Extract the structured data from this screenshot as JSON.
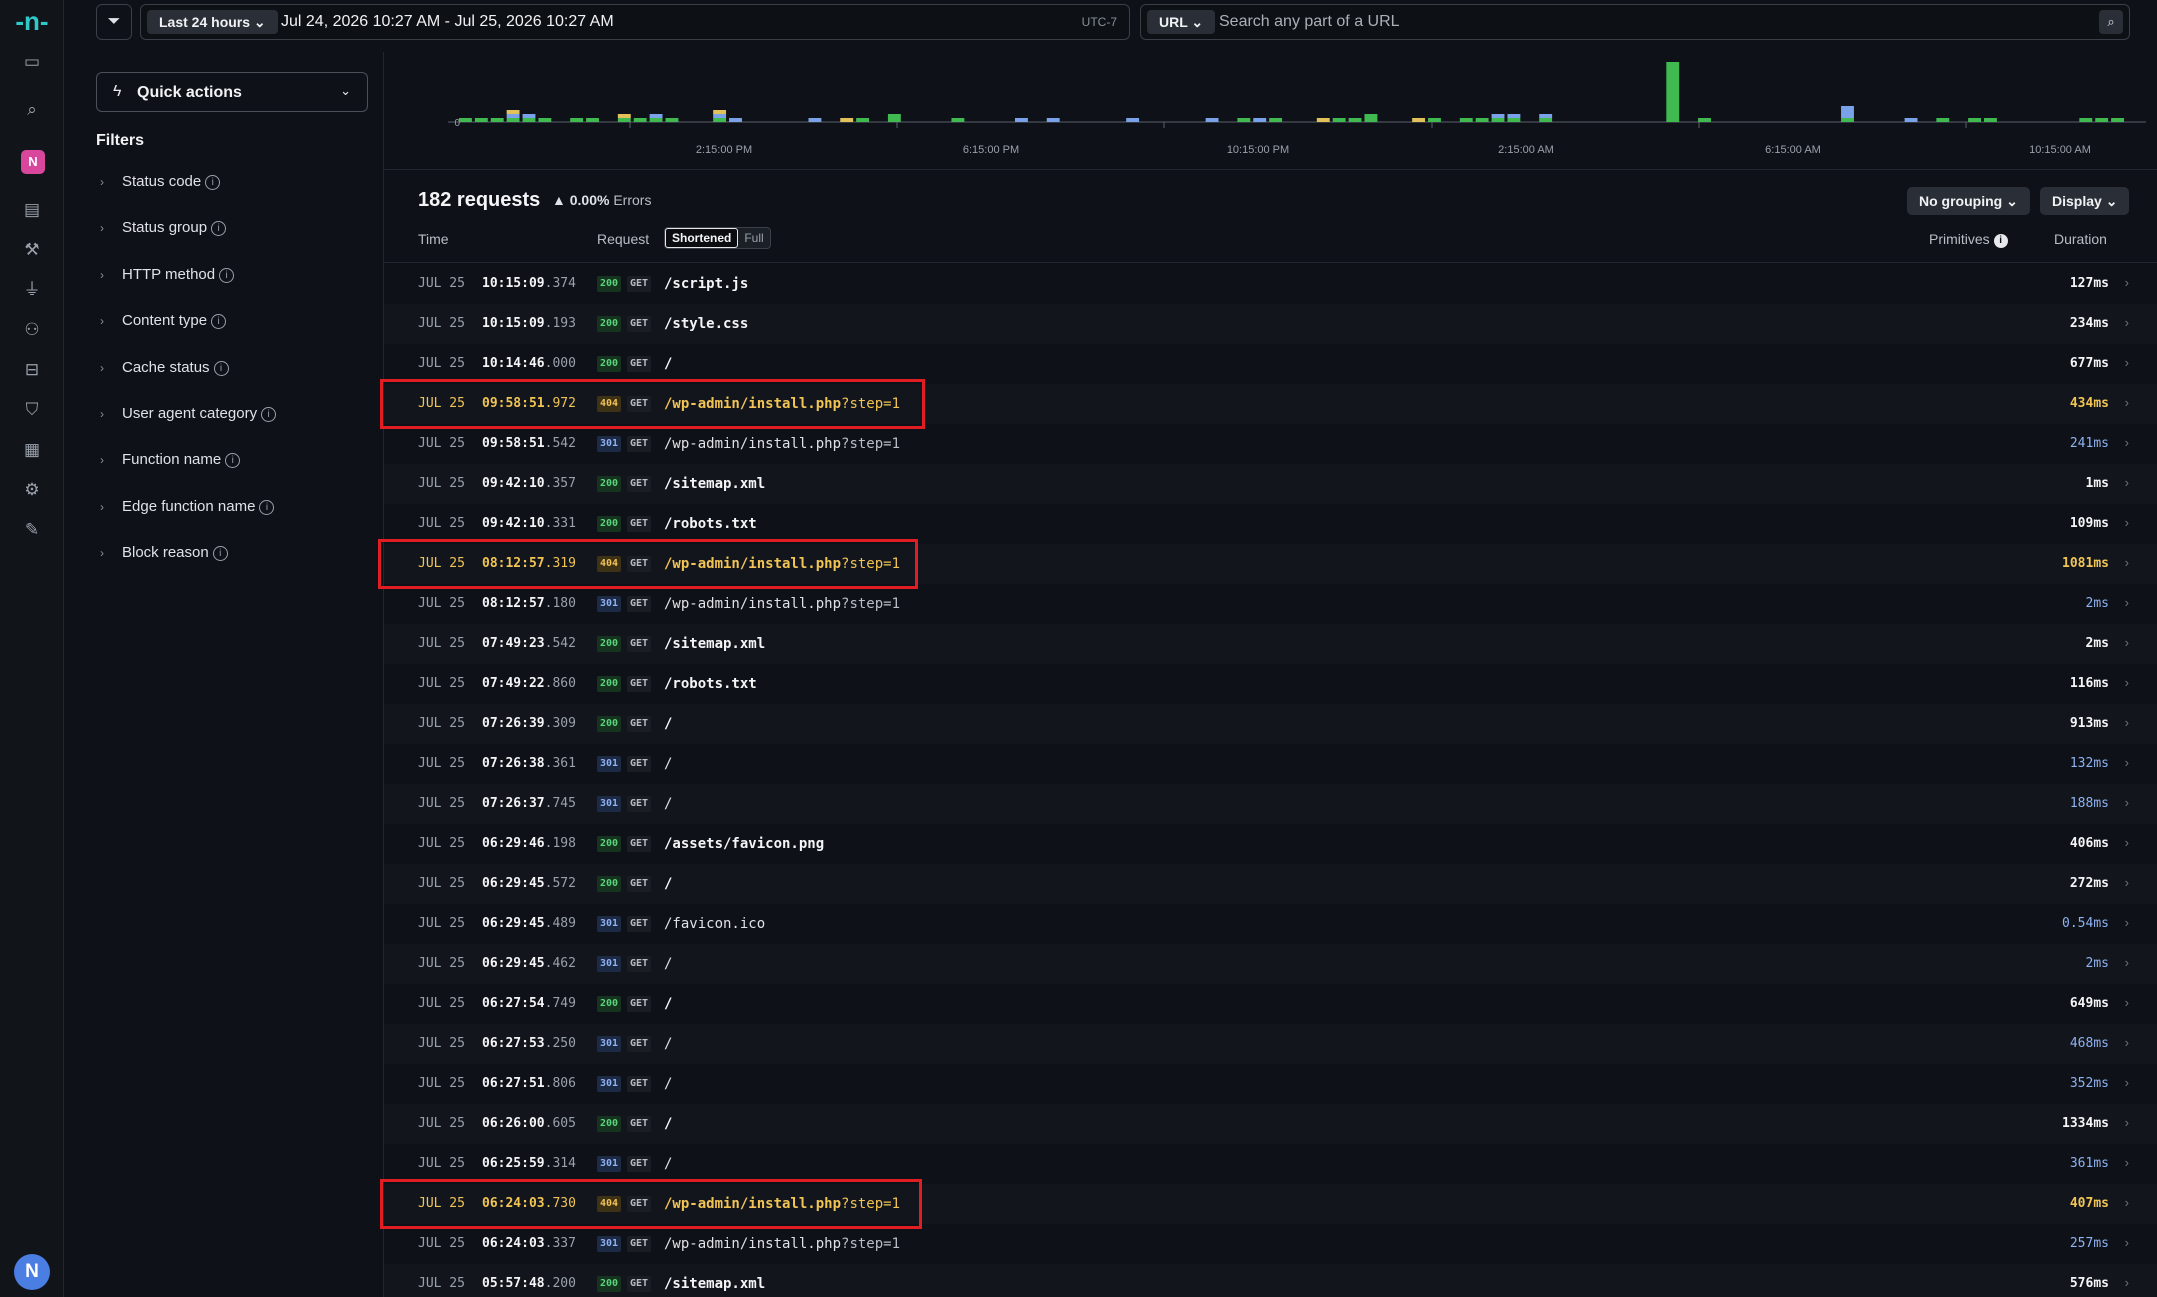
{
  "app": {
    "logo_glyph": "-n-",
    "team_initial": "N",
    "user_initial": "N"
  },
  "rail_icons": [
    "sidebar-toggle-icon",
    "search-icon",
    "team-badge",
    "layers-icon",
    "hammer-icon",
    "plug-icon",
    "users-icon",
    "logs-icon",
    "shield-icon",
    "book-icon",
    "gear-icon",
    "pen-icon"
  ],
  "topbar": {
    "range_label": "Last 24 hours",
    "range_text": "Jul 24, 2026 10:27 AM - Jul 25, 2026 10:27 AM",
    "timezone": "UTC-7",
    "url_scope": "URL",
    "search_placeholder": "Search any part of a URL"
  },
  "sidebar": {
    "quick_actions": "Quick actions",
    "filters_title": "Filters",
    "filters": [
      "Status code",
      "Status group",
      "HTTP method",
      "Content type",
      "Cache status",
      "User agent category",
      "Function name",
      "Edge function name",
      "Block reason"
    ]
  },
  "histogram": {
    "y_zero_label": "0",
    "x_ticks": [
      "2:15:00 PM",
      "6:15:00 PM",
      "10:15:00 PM",
      "2:15:00 AM",
      "6:15:00 AM",
      "10:15:00 AM"
    ],
    "colors": {
      "ok": "#3fb950",
      "redirect": "#7aa2e8",
      "client_error": "#e3c15a"
    },
    "bins": [
      [
        1,
        0,
        0
      ],
      [
        1,
        0,
        0
      ],
      [
        1,
        0,
        0
      ],
      [
        1,
        1,
        1
      ],
      [
        1,
        1,
        0
      ],
      [
        1,
        0,
        0
      ],
      [
        0,
        0,
        0
      ],
      [
        1,
        0,
        0
      ],
      [
        1,
        0,
        0
      ],
      [
        0,
        0,
        0
      ],
      [
        1,
        0,
        1
      ],
      [
        1,
        0,
        0
      ],
      [
        1,
        1,
        0
      ],
      [
        1,
        0,
        0
      ],
      [
        0,
        0,
        0
      ],
      [
        0,
        0,
        0
      ],
      [
        1,
        1,
        1
      ],
      [
        0,
        1,
        0
      ],
      [
        0,
        0,
        0
      ],
      [
        0,
        0,
        0
      ],
      [
        0,
        0,
        0
      ],
      [
        0,
        0,
        0
      ],
      [
        0,
        1,
        0
      ],
      [
        0,
        0,
        0
      ],
      [
        0,
        0,
        1
      ],
      [
        1,
        0,
        0
      ],
      [
        0,
        0,
        0
      ],
      [
        2,
        0,
        0
      ],
      [
        0,
        0,
        0
      ],
      [
        0,
        0,
        0
      ],
      [
        0,
        0,
        0
      ],
      [
        1,
        0,
        0
      ],
      [
        0,
        0,
        0
      ],
      [
        0,
        0,
        0
      ],
      [
        0,
        0,
        0
      ],
      [
        0,
        1,
        0
      ],
      [
        0,
        0,
        0
      ],
      [
        0,
        1,
        0
      ],
      [
        0,
        0,
        0
      ],
      [
        0,
        0,
        0
      ],
      [
        0,
        0,
        0
      ],
      [
        0,
        0,
        0
      ],
      [
        0,
        1,
        0
      ],
      [
        0,
        0,
        0
      ],
      [
        0,
        0,
        0
      ],
      [
        0,
        0,
        0
      ],
      [
        0,
        0,
        0
      ],
      [
        0,
        1,
        0
      ],
      [
        0,
        0,
        0
      ],
      [
        1,
        0,
        0
      ],
      [
        0,
        1,
        0
      ],
      [
        1,
        0,
        0
      ],
      [
        0,
        0,
        0
      ],
      [
        0,
        0,
        0
      ],
      [
        0,
        0,
        1
      ],
      [
        1,
        0,
        0
      ],
      [
        1,
        0,
        0
      ],
      [
        2,
        0,
        0
      ],
      [
        0,
        0,
        0
      ],
      [
        0,
        0,
        0
      ],
      [
        0,
        0,
        1
      ],
      [
        1,
        0,
        0
      ],
      [
        0,
        0,
        0
      ],
      [
        1,
        0,
        0
      ],
      [
        1,
        0,
        0
      ],
      [
        1,
        1,
        0
      ],
      [
        1,
        1,
        0
      ],
      [
        0,
        0,
        0
      ],
      [
        1,
        1,
        0
      ],
      [
        0,
        0,
        0
      ],
      [
        0,
        0,
        0
      ],
      [
        0,
        0,
        0
      ],
      [
        0,
        0,
        0
      ],
      [
        0,
        0,
        0
      ],
      [
        0,
        0,
        0
      ],
      [
        0,
        0,
        0
      ],
      [
        15,
        0,
        0
      ],
      [
        0,
        0,
        0
      ],
      [
        1,
        0,
        0
      ],
      [
        0,
        0,
        0
      ],
      [
        0,
        0,
        0
      ],
      [
        0,
        0,
        0
      ],
      [
        0,
        0,
        0
      ],
      [
        0,
        0,
        0
      ],
      [
        0,
        0,
        0
      ],
      [
        0,
        0,
        0
      ],
      [
        0,
        0,
        0
      ],
      [
        1,
        3,
        0
      ],
      [
        0,
        0,
        0
      ],
      [
        0,
        0,
        0
      ],
      [
        0,
        0,
        0
      ],
      [
        0,
        1,
        0
      ],
      [
        0,
        0,
        0
      ],
      [
        1,
        0,
        0
      ],
      [
        0,
        0,
        0
      ],
      [
        1,
        0,
        0
      ],
      [
        1,
        0,
        0
      ],
      [
        0,
        0,
        0
      ],
      [
        0,
        0,
        0
      ],
      [
        0,
        0,
        0
      ],
      [
        0,
        0,
        0
      ],
      [
        0,
        0,
        0
      ],
      [
        1,
        0,
        0
      ],
      [
        1,
        0,
        0
      ],
      [
        1,
        0,
        0
      ]
    ]
  },
  "summary": {
    "requests": "182 requests",
    "error_rate": "0.00%",
    "errors_label": "Errors",
    "grouping": "No grouping",
    "display": "Display"
  },
  "columns": {
    "time": "Time",
    "request": "Request",
    "shortened": "Shortened",
    "full": "Full",
    "primitives": "Primitives",
    "duration": "Duration"
  },
  "rows": [
    {
      "date": "JUL 25",
      "time": "10:15:09",
      "ms": ".374",
      "status": "200",
      "method": "GET",
      "path": "/script.js",
      "query": "",
      "duration": "127ms",
      "highlight": false
    },
    {
      "date": "JUL 25",
      "time": "10:15:09",
      "ms": ".193",
      "status": "200",
      "method": "GET",
      "path": "/style.css",
      "query": "",
      "duration": "234ms",
      "highlight": false
    },
    {
      "date": "JUL 25",
      "time": "10:14:46",
      "ms": ".000",
      "status": "200",
      "method": "GET",
      "path": "/",
      "query": "",
      "duration": "677ms",
      "highlight": false
    },
    {
      "date": "JUL 25",
      "time": "09:58:51",
      "ms": ".972",
      "status": "404",
      "method": "GET",
      "path": "/wp-admin/install.php",
      "query": "?step=1",
      "duration": "434ms",
      "highlight": true
    },
    {
      "date": "JUL 25",
      "time": "09:58:51",
      "ms": ".542",
      "status": "301",
      "method": "GET",
      "path": "/wp-admin/install.php",
      "query": "?step=1",
      "duration": "241ms",
      "highlight": false
    },
    {
      "date": "JUL 25",
      "time": "09:42:10",
      "ms": ".357",
      "status": "200",
      "method": "GET",
      "path": "/sitemap.xml",
      "query": "",
      "duration": "1ms",
      "highlight": false
    },
    {
      "date": "JUL 25",
      "time": "09:42:10",
      "ms": ".331",
      "status": "200",
      "method": "GET",
      "path": "/robots.txt",
      "query": "",
      "duration": "109ms",
      "highlight": false
    },
    {
      "date": "JUL 25",
      "time": "08:12:57",
      "ms": ".319",
      "status": "404",
      "method": "GET",
      "path": "/wp-admin/install.php",
      "query": "?step=1",
      "duration": "1081ms",
      "highlight": true
    },
    {
      "date": "JUL 25",
      "time": "08:12:57",
      "ms": ".180",
      "status": "301",
      "method": "GET",
      "path": "/wp-admin/install.php",
      "query": "?step=1",
      "duration": "2ms",
      "highlight": false
    },
    {
      "date": "JUL 25",
      "time": "07:49:23",
      "ms": ".542",
      "status": "200",
      "method": "GET",
      "path": "/sitemap.xml",
      "query": "",
      "duration": "2ms",
      "highlight": false
    },
    {
      "date": "JUL 25",
      "time": "07:49:22",
      "ms": ".860",
      "status": "200",
      "method": "GET",
      "path": "/robots.txt",
      "query": "",
      "duration": "116ms",
      "highlight": false
    },
    {
      "date": "JUL 25",
      "time": "07:26:39",
      "ms": ".309",
      "status": "200",
      "method": "GET",
      "path": "/",
      "query": "",
      "duration": "913ms",
      "highlight": false
    },
    {
      "date": "JUL 25",
      "time": "07:26:38",
      "ms": ".361",
      "status": "301",
      "method": "GET",
      "path": "/",
      "query": "",
      "duration": "132ms",
      "highlight": false
    },
    {
      "date": "JUL 25",
      "time": "07:26:37",
      "ms": ".745",
      "status": "301",
      "method": "GET",
      "path": "/",
      "query": "",
      "duration": "188ms",
      "highlight": false
    },
    {
      "date": "JUL 25",
      "time": "06:29:46",
      "ms": ".198",
      "status": "200",
      "method": "GET",
      "path": "/assets/favicon.png",
      "query": "",
      "duration": "406ms",
      "highlight": false
    },
    {
      "date": "JUL 25",
      "time": "06:29:45",
      "ms": ".572",
      "status": "200",
      "method": "GET",
      "path": "/",
      "query": "",
      "duration": "272ms",
      "highlight": false
    },
    {
      "date": "JUL 25",
      "time": "06:29:45",
      "ms": ".489",
      "status": "301",
      "method": "GET",
      "path": "/favicon.ico",
      "query": "",
      "duration": "0.54ms",
      "highlight": false
    },
    {
      "date": "JUL 25",
      "time": "06:29:45",
      "ms": ".462",
      "status": "301",
      "method": "GET",
      "path": "/",
      "query": "",
      "duration": "2ms",
      "highlight": false
    },
    {
      "date": "JUL 25",
      "time": "06:27:54",
      "ms": ".749",
      "status": "200",
      "method": "GET",
      "path": "/",
      "query": "",
      "duration": "649ms",
      "highlight": false
    },
    {
      "date": "JUL 25",
      "time": "06:27:53",
      "ms": ".250",
      "status": "301",
      "method": "GET",
      "path": "/",
      "query": "",
      "duration": "468ms",
      "highlight": false
    },
    {
      "date": "JUL 25",
      "time": "06:27:51",
      "ms": ".806",
      "status": "301",
      "method": "GET",
      "path": "/",
      "query": "",
      "duration": "352ms",
      "highlight": false
    },
    {
      "date": "JUL 25",
      "time": "06:26:00",
      "ms": ".605",
      "status": "200",
      "method": "GET",
      "path": "/",
      "query": "",
      "duration": "1334ms",
      "highlight": false
    },
    {
      "date": "JUL 25",
      "time": "06:25:59",
      "ms": ".314",
      "status": "301",
      "method": "GET",
      "path": "/",
      "query": "",
      "duration": "361ms",
      "highlight": false
    },
    {
      "date": "JUL 25",
      "time": "06:24:03",
      "ms": ".730",
      "status": "404",
      "method": "GET",
      "path": "/wp-admin/install.php",
      "query": "?step=1",
      "duration": "407ms",
      "highlight": true
    },
    {
      "date": "JUL 25",
      "time": "06:24:03",
      "ms": ".337",
      "status": "301",
      "method": "GET",
      "path": "/wp-admin/install.php",
      "query": "?step=1",
      "duration": "257ms",
      "highlight": false
    },
    {
      "date": "JUL 25",
      "time": "05:57:48",
      "ms": ".200",
      "status": "200",
      "method": "GET",
      "path": "/sitemap.xml",
      "query": "",
      "duration": "576ms",
      "highlight": false
    }
  ]
}
